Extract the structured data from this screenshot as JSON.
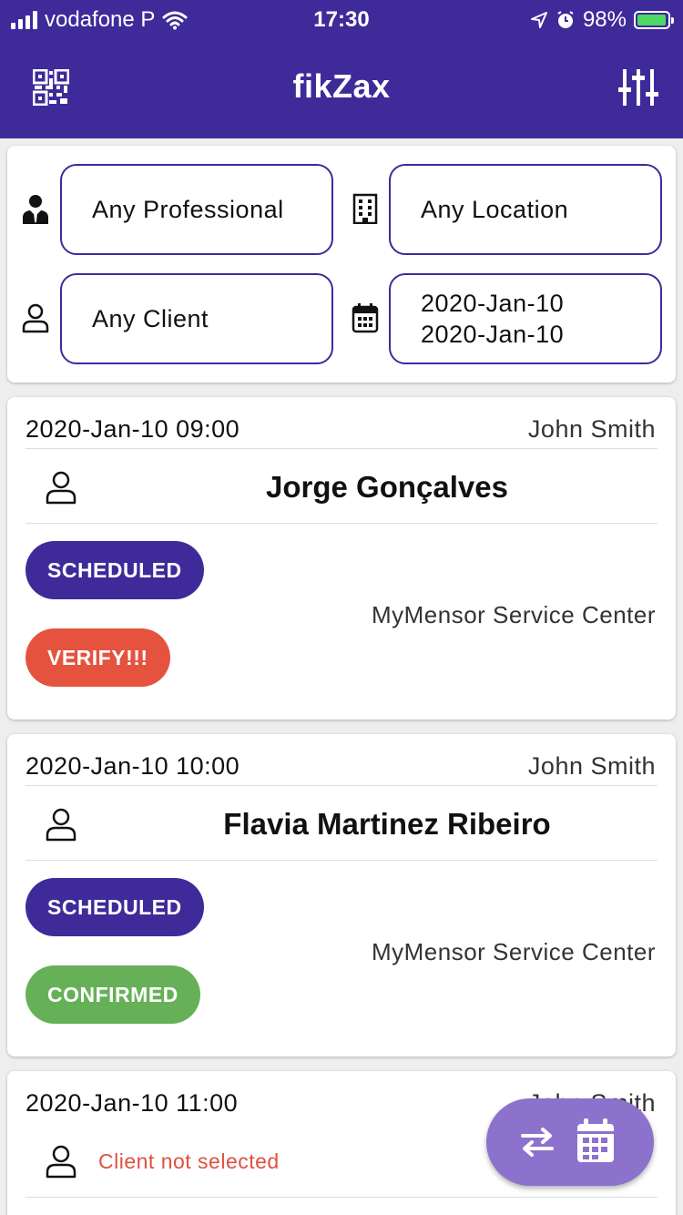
{
  "status_bar": {
    "carrier": "vodafone P",
    "time": "17:30",
    "battery": "98%",
    "battery_level": 0.98
  },
  "app_bar": {
    "title": "fikZax",
    "left_icon": "qr-code-icon",
    "right_icon": "tune-icon"
  },
  "filters": {
    "professional": "Any Professional",
    "location": "Any Location",
    "client": "Any Client",
    "date_from": "2020-Jan-10",
    "date_to": "2020-Jan-10"
  },
  "appointments": [
    {
      "datetime": "2020-Jan-10 09:00",
      "professional": "John Smith",
      "client": "Jorge Gonçalves",
      "status": "SCHEDULED",
      "flag": "VERIFY!!!",
      "location": "MyMensor Service Center"
    },
    {
      "datetime": "2020-Jan-10 10:00",
      "professional": "John Smith",
      "client": "Flavia Martinez Ribeiro",
      "status": "SCHEDULED",
      "flag": "CONFIRMED",
      "location": "MyMensor Service Center"
    },
    {
      "datetime": "2020-Jan-10 11:00",
      "professional": "John Smith",
      "client": "Client not selected"
    }
  ],
  "colors": {
    "primary": "#3f2a9a",
    "scheduled": "#3f2a9a",
    "verify": "#e5533f",
    "confirmed": "#66b158",
    "fab": "#8c72cc",
    "warning_text": "#e05040"
  }
}
